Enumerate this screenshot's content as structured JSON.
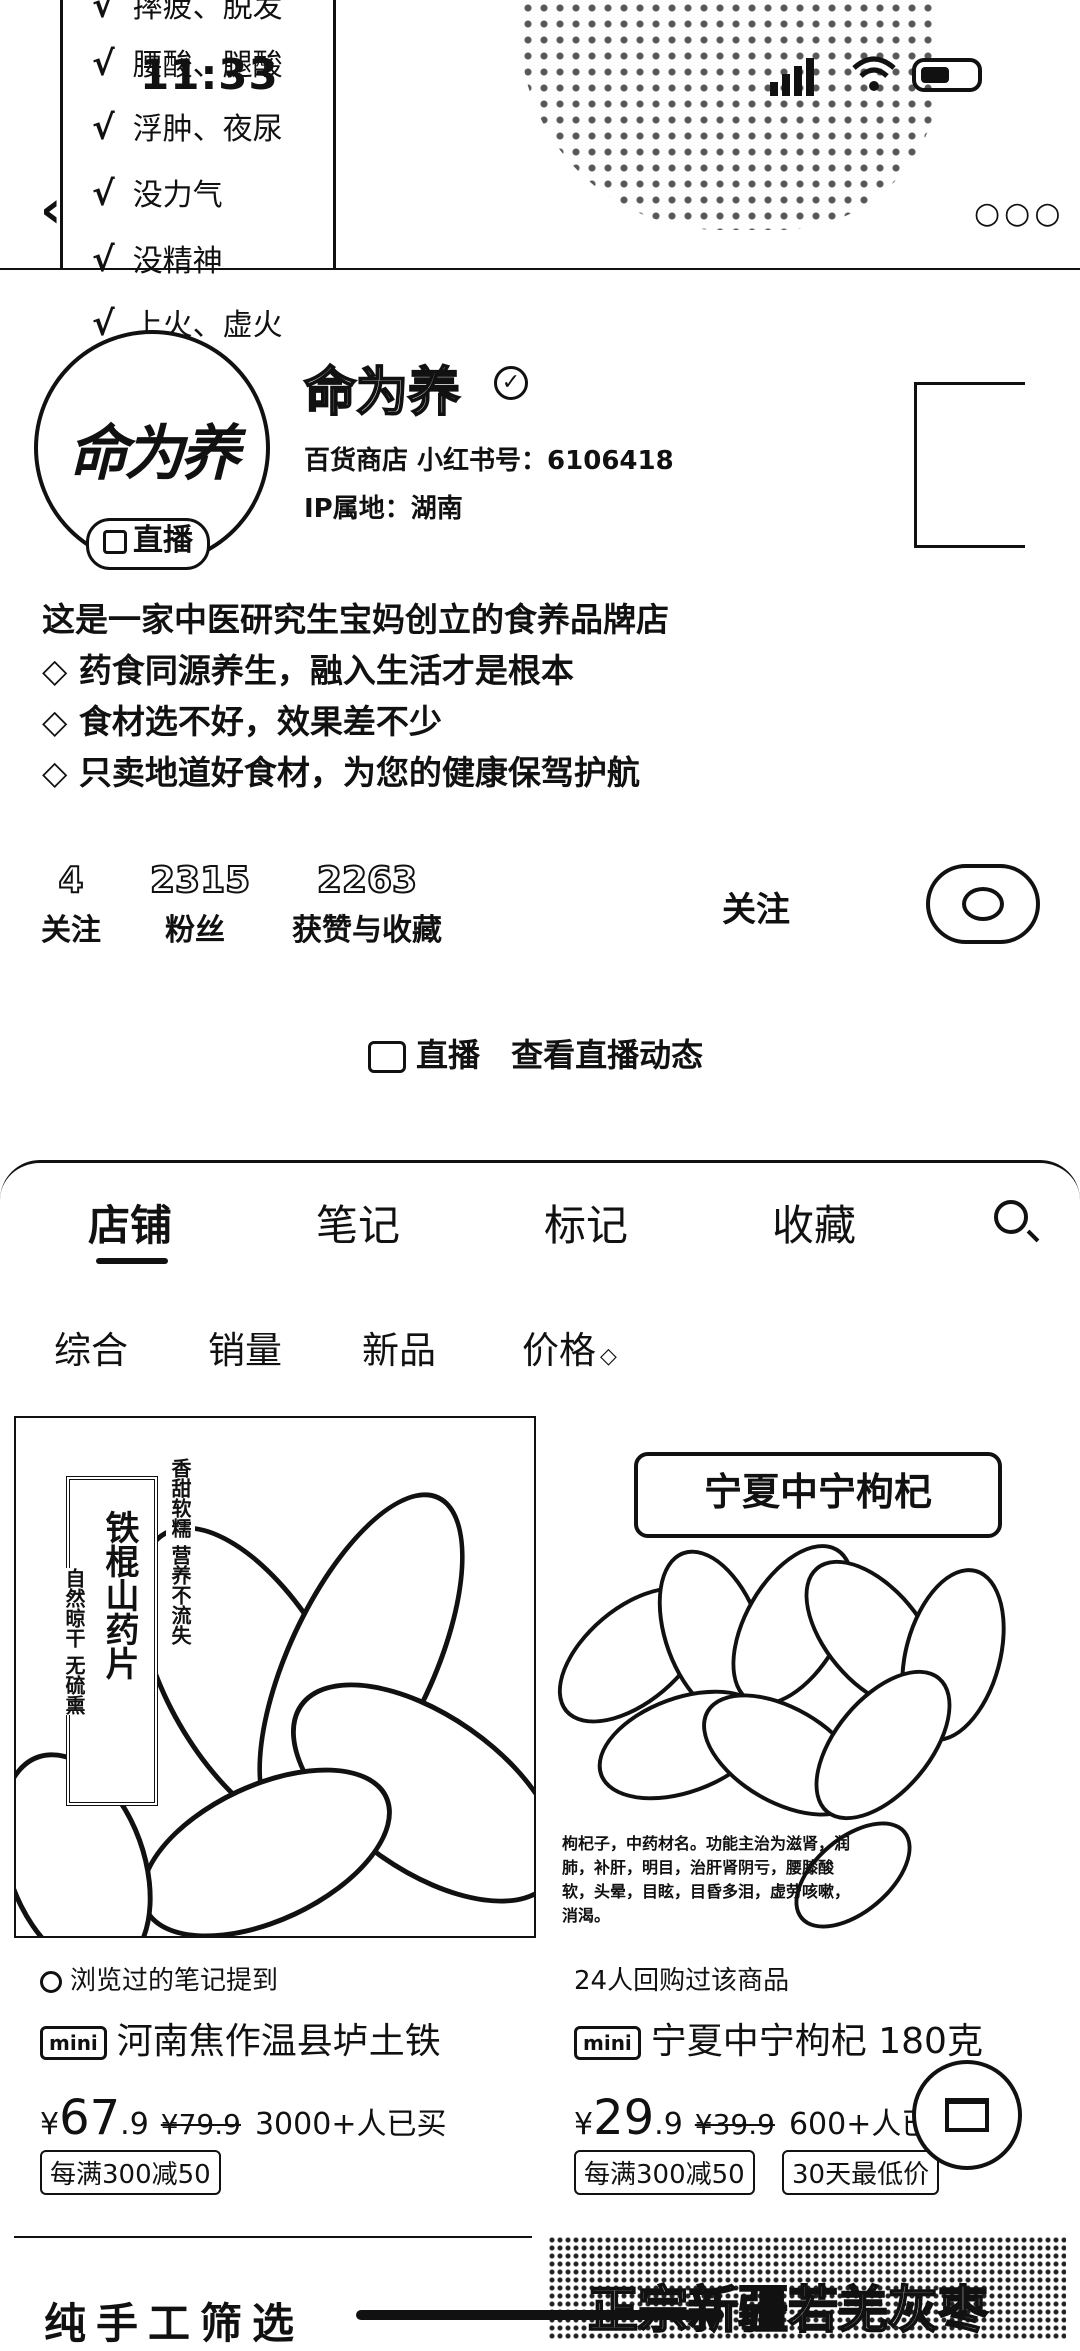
{
  "status_bar": {
    "time": "11:33"
  },
  "background_checklist": [
    "摔疲、脱发",
    "腰酸、腿酸",
    "浮肿、夜尿",
    "没力气",
    "没精神",
    "上火、虚火"
  ],
  "profile": {
    "logo_text": "命为养",
    "name": "命为养",
    "meta_line1": "百货商店  小红书号：6106418",
    "meta_line2": "IP属地：湖南",
    "live_tag": "直播",
    "bio": [
      "这是一家中医研究生宝妈创立的食养品牌店",
      "◇ 药食同源养生，融入生活才是根本",
      "◇ 食材选不好，效果差不少",
      "◇ 只卖地道好食材，为您的健康保驾护航"
    ],
    "stats": [
      {
        "value": "4",
        "label": "关注"
      },
      {
        "value": "2315",
        "label": "粉丝"
      },
      {
        "value": "2263",
        "label": "获赞与收藏"
      }
    ],
    "follow_label": "关注",
    "live_row": {
      "live": "直播",
      "text": "查看直播动态"
    }
  },
  "tabs": [
    "店铺",
    "笔记",
    "标记",
    "收藏"
  ],
  "sort_options": [
    "综合",
    "销量",
    "新品",
    "价格"
  ],
  "products": [
    {
      "image_label": "铁棍山药片",
      "image_side_texts": [
        "自然晾干 无硫熏",
        "香甜软糯 营养不流失"
      ],
      "tag": "浏览过的笔记提到",
      "badge": "mini",
      "title": "河南焦作温县垆土铁",
      "price_int": "67",
      "price_dec": ".9",
      "old_price": "¥79.9",
      "sold": "3000+人已买",
      "coupons": [
        "每满300减50"
      ]
    },
    {
      "image_label": "宁夏中宁枸杞",
      "image_note": "枸杞子，中药材名。功能主治为滋肾，润肺，补肝，明目，治肝肾阴亏，腰膝酸软，头晕，目眩，目昏多泪，虚劳咳嗽，消渴。",
      "tag": "24人回购过该商品",
      "badge": "mini",
      "title": "宁夏中宁枸杞 180克",
      "price_int": "29",
      "price_dec": ".9",
      "old_price": "¥39.9",
      "sold": "600+人已买",
      "coupons": [
        "每满300减50",
        "30天最低价"
      ]
    }
  ],
  "bottom_cards": [
    "纯手工筛选",
    "正宗新疆若羌灰枣"
  ]
}
